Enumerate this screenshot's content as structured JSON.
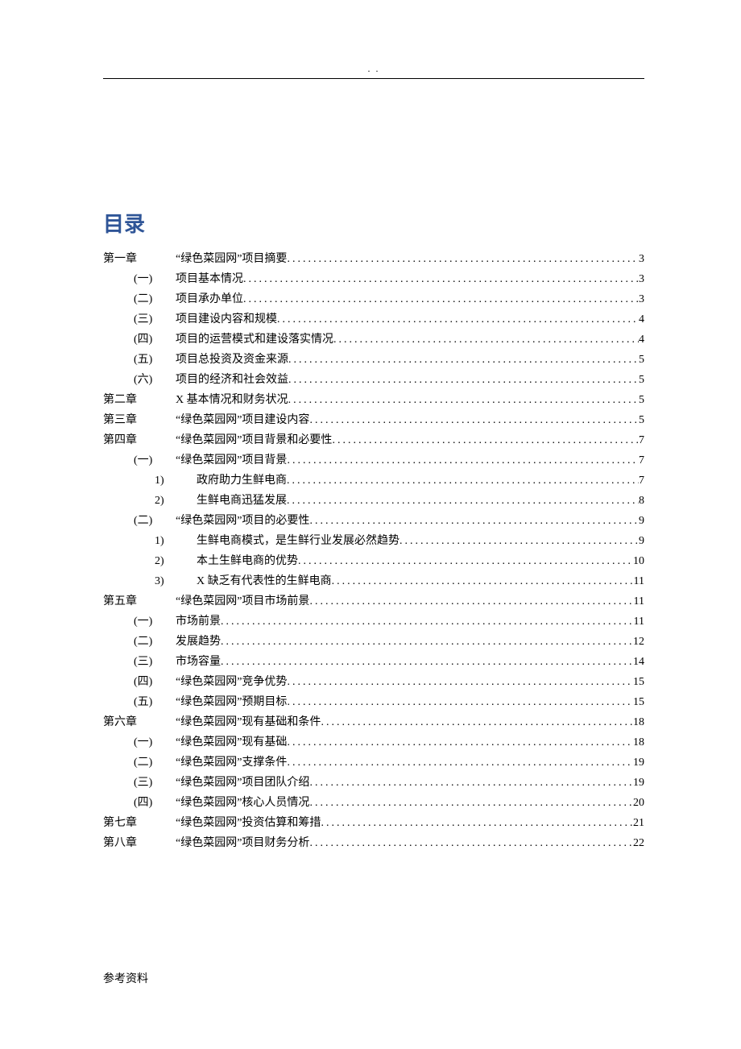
{
  "header_dots": ". .",
  "title": "目录",
  "footer": "参考资料",
  "toc": [
    {
      "level": 0,
      "label": "第一章",
      "text": "“绿色菜园网”项目摘要",
      "page": "3"
    },
    {
      "level": 1,
      "label": "(一)",
      "text": "项目基本情况",
      "page": "3"
    },
    {
      "level": 1,
      "label": "(二)",
      "text": "项目承办单位",
      "page": "3"
    },
    {
      "level": 1,
      "label": "(三)",
      "text": "项目建设内容和规模",
      "page": "4"
    },
    {
      "level": 1,
      "label": "(四)",
      "text": "项目的运营模式和建设落实情况",
      "page": "4"
    },
    {
      "level": 1,
      "label": "(五)",
      "text": "项目总投资及资金来源",
      "page": "5"
    },
    {
      "level": 1,
      "label": "(六)",
      "text": "项目的经济和社会效益",
      "page": "5"
    },
    {
      "level": 0,
      "label": "第二章",
      "text": "X 基本情况和财务状况",
      "page": "5"
    },
    {
      "level": 0,
      "label": "第三章",
      "text": "“绿色菜园网”项目建设内容",
      "page": "5"
    },
    {
      "level": 0,
      "label": "第四章",
      "text": "“绿色菜园网”项目背景和必要性",
      "page": "7"
    },
    {
      "level": 1,
      "label": "(一)",
      "text": "“绿色菜园网”项目背景",
      "page": "7"
    },
    {
      "level": 2,
      "label": "1)",
      "text": "政府助力生鲜电商",
      "page": "7"
    },
    {
      "level": 2,
      "label": "2)",
      "text": "生鲜电商迅猛发展",
      "page": "8"
    },
    {
      "level": 1,
      "label": "(二)",
      "text": "“绿色菜园网”项目的必要性",
      "page": "9"
    },
    {
      "level": 2,
      "label": "1)",
      "text": "生鲜电商模式，是生鲜行业发展必然趋势",
      "page": "9"
    },
    {
      "level": 2,
      "label": "2)",
      "text": "本土生鲜电商的优势",
      "page": "10"
    },
    {
      "level": 2,
      "label": "3)",
      "text": "X 缺乏有代表性的生鲜电商",
      "page": "11"
    },
    {
      "level": 0,
      "label": "第五章",
      "text": "“绿色菜园网”项目市场前景",
      "page": "11"
    },
    {
      "level": 1,
      "label": "(一)",
      "text": "市场前景",
      "page": "11"
    },
    {
      "level": 1,
      "label": "(二)",
      "text": "发展趋势",
      "page": "12"
    },
    {
      "level": 1,
      "label": "(三)",
      "text": "市场容量",
      "page": "14"
    },
    {
      "level": 1,
      "label": "(四)",
      "text": "“绿色菜园网”竞争优势",
      "page": "15"
    },
    {
      "level": 1,
      "label": "(五)",
      "text": "“绿色菜园网”预期目标",
      "page": "15"
    },
    {
      "level": 0,
      "label": "第六章",
      "text": "“绿色菜园网”现有基础和条件",
      "page": "18"
    },
    {
      "level": 1,
      "label": "(一)",
      "text": "“绿色菜园网”现有基础",
      "page": "18"
    },
    {
      "level": 1,
      "label": "(二)",
      "text": "“绿色菜园网”支撑条件",
      "page": "19"
    },
    {
      "level": 1,
      "label": "(三)",
      "text": "“绿色菜园网”项目团队介绍",
      "page": "19"
    },
    {
      "level": 1,
      "label": "(四)",
      "text": "“绿色菜园网”核心人员情况",
      "page": "20"
    },
    {
      "level": 0,
      "label": "第七章",
      "text": "“绿色菜园网”投资估算和筹措",
      "page": "21"
    },
    {
      "level": 0,
      "label": "第八章",
      "text": "“绿色菜园网”项目财务分析",
      "page": "22"
    }
  ]
}
